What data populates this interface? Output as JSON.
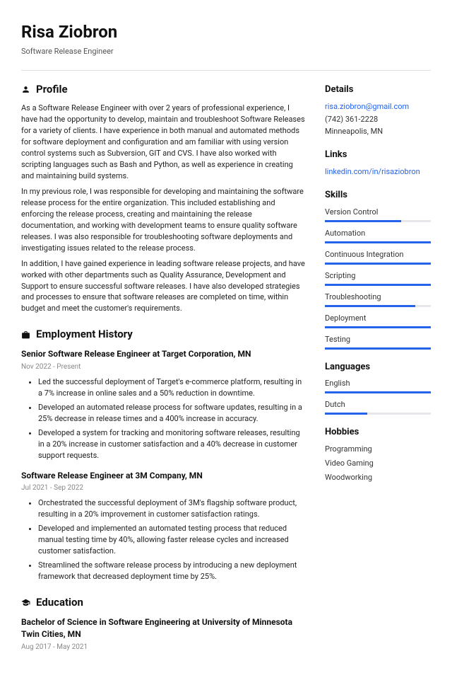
{
  "header": {
    "name": "Risa Ziobron",
    "subtitle": "Software Release Engineer"
  },
  "sections": {
    "profile_title": "Profile",
    "employment_title": "Employment History",
    "education_title": "Education"
  },
  "profile": {
    "p1": "As a Software Release Engineer with over 2 years of professional experience, I have had the opportunity to develop, maintain and troubleshoot Software Releases for a variety of clients. I have experience in both manual and automated methods for software deployment and configuration and am familiar with using version control systems such as Subversion, GIT and CVS. I have also worked with scripting languages such as Bash and Python, as well as experience in creating and maintaining build systems.",
    "p2": "In my previous role, I was responsible for developing and maintaining the software release process for the entire organization. This included establishing and enforcing the release process, creating and maintaining the release documentation, and working with development teams to ensure quality software releases. I was also responsible for troubleshooting software deployments and investigating issues related to the release process.",
    "p3": "In addition, I have gained experience in leading software release projects, and have worked with other departments such as Quality Assurance, Development and Support to ensure successful software releases. I have also developed strategies and processes to ensure that software releases are completed on time, within budget and meet the customer's requirements."
  },
  "jobs": [
    {
      "title": "Senior Software Release Engineer at Target Corporation, MN",
      "date": "Nov 2022 - Present",
      "bullets": [
        "Led the successful deployment of Target's e-commerce platform, resulting in a 7% increase in online sales and a 50% reduction in downtime.",
        "Developed an automated release process for software updates, resulting in a 25% decrease in release times and a 400% increase in accuracy.",
        "Developed a system for tracking and monitoring software releases, resulting in a 20% increase in customer satisfaction and a 40% decrease in customer support requests."
      ]
    },
    {
      "title": "Software Release Engineer at 3M Company, MN",
      "date": "Jul 2021 - Sep 2022",
      "bullets": [
        "Orchestrated the successful deployment of 3M's flagship software product, resulting in a 20% improvement in customer satisfaction ratings.",
        "Developed and implemented an automated testing process that reduced manual testing time by 40%, allowing faster release cycles and increased customer satisfaction.",
        "Streamlined the software release process by introducing a new deployment framework that decreased deployment time by 25%."
      ]
    }
  ],
  "education": {
    "title": "Bachelor of Science in Software Engineering at University of Minnesota Twin Cities, MN",
    "date": "Aug 2017 - May 2021"
  },
  "side": {
    "details_title": "Details",
    "email": "risa.ziobron@gmail.com",
    "phone": "(742) 361-2228",
    "location": "Minneapolis, MN",
    "links_title": "Links",
    "linkedin": "linkedin.com/in/risaziobron",
    "skills_title": "Skills",
    "skills": [
      {
        "name": "Version Control",
        "level": 72
      },
      {
        "name": "Automation",
        "level": 100
      },
      {
        "name": "Continuous Integration",
        "level": 100
      },
      {
        "name": "Scripting",
        "level": 100
      },
      {
        "name": "Troubleshooting",
        "level": 85
      },
      {
        "name": "Deployment",
        "level": 100
      },
      {
        "name": "Testing",
        "level": 100
      }
    ],
    "languages_title": "Languages",
    "languages": [
      {
        "name": "English",
        "level": 100
      },
      {
        "name": "Dutch",
        "level": 40
      }
    ],
    "hobbies_title": "Hobbies",
    "hobbies": [
      "Programming",
      "Video Gaming",
      "Woodworking"
    ]
  }
}
